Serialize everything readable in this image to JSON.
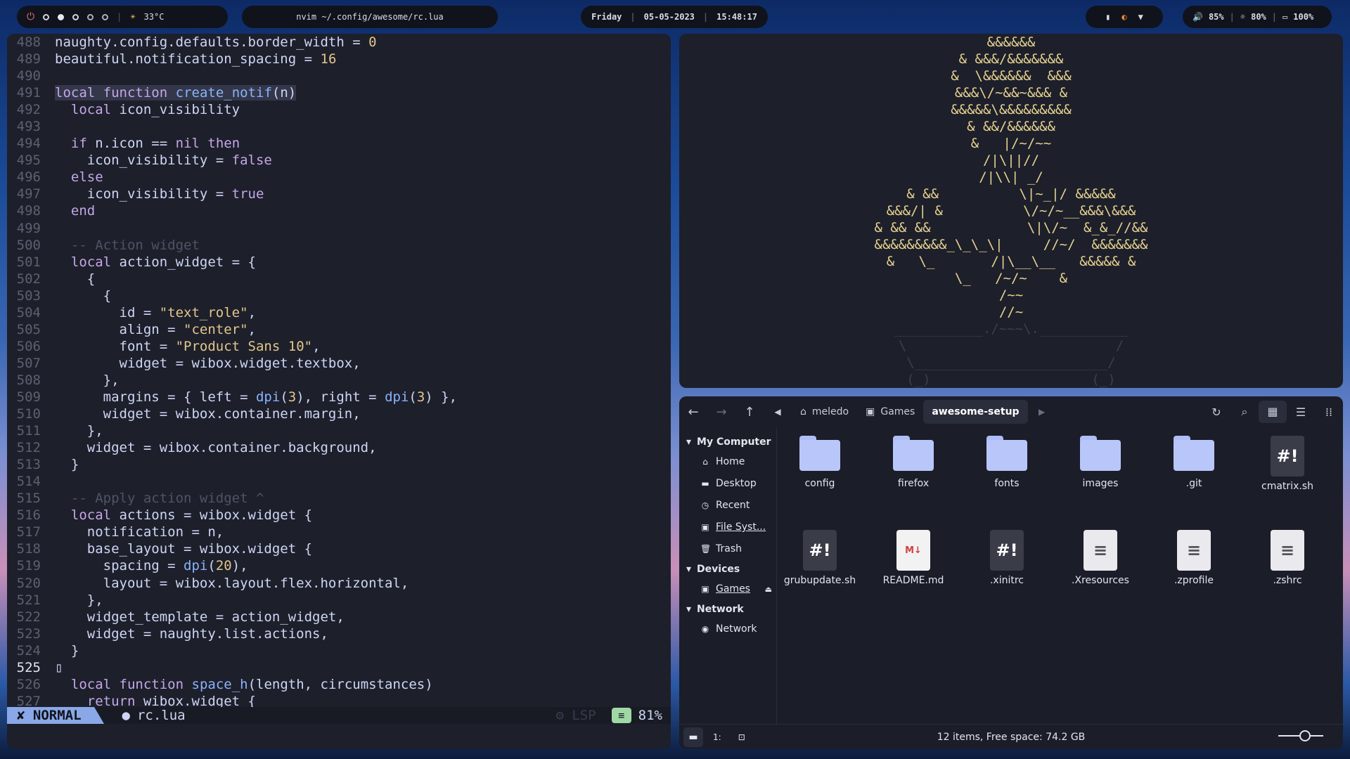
{
  "topbar": {
    "power_icon": "power-icon",
    "weather_icon": "sun-icon",
    "temperature": "33°C",
    "window_title": "nvim ~/.config/awesome/rc.lua",
    "day": "Friday",
    "date": "05-05-2023",
    "time": "15:48:17",
    "volume": "85%",
    "brightness": "80%",
    "battery": "100%"
  },
  "editor": {
    "mode": "NORMAL",
    "file": "rc.lua",
    "lsp": "LSP",
    "percent": "81%",
    "accent": "#8aa8e8"
  },
  "art": {
    "lines": [
      "&&&&&&",
      "& &&&/&&&&&&&",
      "&  \\&&&&&&  &&&",
      "&&&\\/~&&~&&& &",
      "&&&&&\\&&&&&&&&&",
      "& &&/&&&&&&",
      "&   |/~/~~",
      "/|\\||//",
      "/|\\\\| _/",
      "& &&          \\|~_|/ &&&&&",
      "&&&/| &          \\/~/~__&&&\\&&&",
      "& && &&            \\|\\/~  &_&_//&&",
      "&&&&&&&&&_\\_\\_\\|     //~/  &&&&&&&",
      "&   \\_       /|\\__\\__   &&&&& &",
      "\\_   /~/~    &",
      "/~~",
      "//~",
      "___________./~~~\\.___________",
      "\\                          /",
      "\\________________________/",
      "(_)                    (_)"
    ]
  },
  "files": {
    "path": [
      "meledo",
      "Games",
      "awesome-setup"
    ],
    "sidebar": {
      "sections": [
        {
          "title": "My Computer",
          "items": [
            "Home",
            "Desktop",
            "Recent",
            "File Syst...",
            "Trash"
          ]
        },
        {
          "title": "Devices",
          "items": [
            "Games"
          ]
        },
        {
          "title": "Network",
          "items": [
            "Network"
          ]
        }
      ]
    },
    "items": [
      {
        "name": "config",
        "type": "folder"
      },
      {
        "name": "firefox",
        "type": "folder"
      },
      {
        "name": "fonts",
        "type": "folder"
      },
      {
        "name": "images",
        "type": "folder"
      },
      {
        "name": ".git",
        "type": "folder"
      },
      {
        "name": "cmatrix.sh",
        "type": "shell"
      },
      {
        "name": "grubupdate.sh",
        "type": "shell"
      },
      {
        "name": "README.md",
        "type": "markdown"
      },
      {
        "name": ".xinitrc",
        "type": "shell"
      },
      {
        "name": ".Xresources",
        "type": "text"
      },
      {
        "name": ".zprofile",
        "type": "text"
      },
      {
        "name": ".zshrc",
        "type": "text"
      }
    ],
    "status": "12 items, Free space: 74.2 GB",
    "zoom_label": "1:"
  },
  "code": [
    {
      "n": "488",
      "t": "naughty.config.defaults.border_width = 0"
    },
    {
      "n": "489",
      "t": "beautiful.notification_spacing = 16"
    },
    {
      "n": "490",
      "t": ""
    },
    {
      "n": "491",
      "t": "local function create_notif(n)"
    },
    {
      "n": "492",
      "t": "  local icon_visibility"
    },
    {
      "n": "493",
      "t": ""
    },
    {
      "n": "494",
      "t": "  if n.icon == nil then"
    },
    {
      "n": "495",
      "t": "    icon_visibility = false"
    },
    {
      "n": "496",
      "t": "  else"
    },
    {
      "n": "497",
      "t": "    icon_visibility = true"
    },
    {
      "n": "498",
      "t": "  end"
    },
    {
      "n": "499",
      "t": ""
    },
    {
      "n": "500",
      "t": "  -- Action widget"
    },
    {
      "n": "501",
      "t": "  local action_widget = {"
    },
    {
      "n": "502",
      "t": "    {"
    },
    {
      "n": "503",
      "t": "      {"
    },
    {
      "n": "504",
      "t": "        id = \"text_role\","
    },
    {
      "n": "505",
      "t": "        align = \"center\","
    },
    {
      "n": "506",
      "t": "        font = \"Product Sans 10\","
    },
    {
      "n": "507",
      "t": "        widget = wibox.widget.textbox,"
    },
    {
      "n": "508",
      "t": "      },"
    },
    {
      "n": "509",
      "t": "      margins = { left = dpi(3), right = dpi(3) },"
    },
    {
      "n": "510",
      "t": "      widget = wibox.container.margin,"
    },
    {
      "n": "511",
      "t": "    },"
    },
    {
      "n": "512",
      "t": "    widget = wibox.container.background,"
    },
    {
      "n": "513",
      "t": "  }"
    },
    {
      "n": "514",
      "t": ""
    },
    {
      "n": "515",
      "t": "  -- Apply action widget ^"
    },
    {
      "n": "516",
      "t": "  local actions = wibox.widget {"
    },
    {
      "n": "517",
      "t": "    notification = n,"
    },
    {
      "n": "518",
      "t": "    base_layout = wibox.widget {"
    },
    {
      "n": "519",
      "t": "      spacing = dpi(20),"
    },
    {
      "n": "520",
      "t": "      layout = wibox.layout.flex.horizontal,"
    },
    {
      "n": "521",
      "t": "    },"
    },
    {
      "n": "522",
      "t": "    widget_template = action_widget,"
    },
    {
      "n": "523",
      "t": "    widget = naughty.list.actions,"
    },
    {
      "n": "524",
      "t": "  }"
    },
    {
      "n": "525",
      "t": "▯"
    },
    {
      "n": "526",
      "t": "  local function space_h(length, circumstances)"
    },
    {
      "n": "527",
      "t": "    return wibox.widget {"
    }
  ]
}
